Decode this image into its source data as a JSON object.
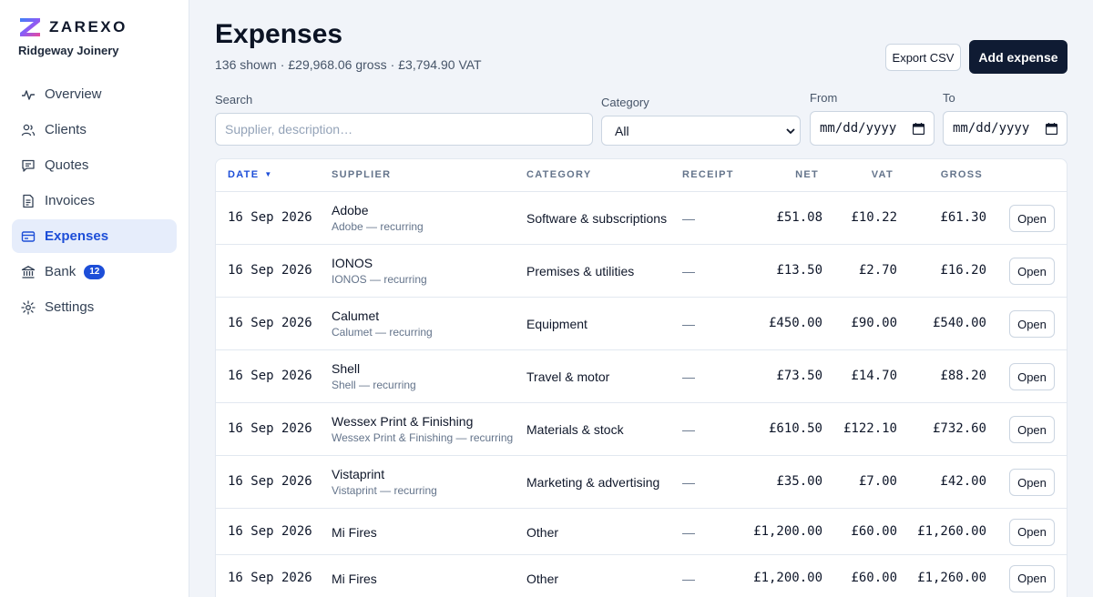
{
  "brand": {
    "name": "ZAREXO",
    "company": "Ridgeway Joinery"
  },
  "nav": [
    {
      "label": "Overview",
      "icon": "activity-icon"
    },
    {
      "label": "Clients",
      "icon": "users-icon"
    },
    {
      "label": "Quotes",
      "icon": "message-square-icon"
    },
    {
      "label": "Invoices",
      "icon": "file-text-icon"
    },
    {
      "label": "Expenses",
      "icon": "receipt-icon",
      "active": true
    },
    {
      "label": "Bank",
      "icon": "bank-icon",
      "badge": "12"
    },
    {
      "label": "Settings",
      "icon": "gear-icon"
    }
  ],
  "header": {
    "title": "Expenses",
    "count": "136 shown",
    "gross": "£29,968.06 gross",
    "vat": "£3,794.90 VAT",
    "export_label": "Export CSV",
    "add_label": "Add expense"
  },
  "filters": {
    "search_label": "Search",
    "search_placeholder": "Supplier, description…",
    "category_label": "Category",
    "category_value": "All",
    "from_label": "From",
    "from_value": "mm/dd/yyyy",
    "to_label": "To",
    "to_value": "mm/dd/yyyy"
  },
  "table": {
    "columns": {
      "date": "DATE",
      "supplier": "SUPPLIER",
      "category": "CATEGORY",
      "receipt": "RECEIPT",
      "net": "NET",
      "vat": "VAT",
      "gross": "GROSS"
    },
    "sort_indicator": "▼",
    "open_label": "Open",
    "rows": [
      {
        "date": "16 Sep 2026",
        "supplier": "Adobe",
        "sub": "Adobe — recurring",
        "category": "Software & subscriptions",
        "receipt": "—",
        "net": "£51.08",
        "vat": "£10.22",
        "gross": "£61.30"
      },
      {
        "date": "16 Sep 2026",
        "supplier": "IONOS",
        "sub": "IONOS — recurring",
        "category": "Premises & utilities",
        "receipt": "—",
        "net": "£13.50",
        "vat": "£2.70",
        "gross": "£16.20"
      },
      {
        "date": "16 Sep 2026",
        "supplier": "Calumet",
        "sub": "Calumet — recurring",
        "category": "Equipment",
        "receipt": "—",
        "net": "£450.00",
        "vat": "£90.00",
        "gross": "£540.00"
      },
      {
        "date": "16 Sep 2026",
        "supplier": "Shell",
        "sub": "Shell — recurring",
        "category": "Travel & motor",
        "receipt": "—",
        "net": "£73.50",
        "vat": "£14.70",
        "gross": "£88.20"
      },
      {
        "date": "16 Sep 2026",
        "supplier": "Wessex Print & Finishing",
        "sub": "Wessex Print & Finishing — recurring",
        "category": "Materials & stock",
        "receipt": "—",
        "net": "£610.50",
        "vat": "£122.10",
        "gross": "£732.60"
      },
      {
        "date": "16 Sep 2026",
        "supplier": "Vistaprint",
        "sub": "Vistaprint — recurring",
        "category": "Marketing & advertising",
        "receipt": "—",
        "net": "£35.00",
        "vat": "£7.00",
        "gross": "£42.00"
      },
      {
        "date": "16 Sep 2026",
        "supplier": "Mi Fires",
        "sub": "",
        "category": "Other",
        "receipt": "—",
        "net": "£1,200.00",
        "vat": "£60.00",
        "gross": "£1,260.00"
      },
      {
        "date": "16 Sep 2026",
        "supplier": "Mi Fires",
        "sub": "",
        "category": "Other",
        "receipt": "—",
        "net": "£1,200.00",
        "vat": "£60.00",
        "gross": "£1,260.00"
      }
    ]
  },
  "colors": {
    "accent": "#1d4ed8",
    "primary_button": "#0f1b33",
    "active_nav_bg": "#e6edfb"
  }
}
